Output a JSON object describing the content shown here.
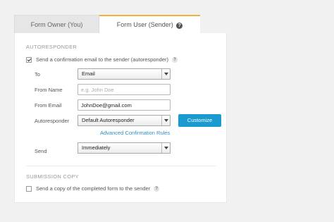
{
  "tabs": {
    "owner_label": "Form Owner (You)",
    "user_label": "Form User (Sender)",
    "user_help": "?"
  },
  "autoresponder": {
    "section_title": "AUTORESPONDER",
    "checkbox_label": "Send a confirmation email to the sender (autoresponder)",
    "checkbox_checked": true,
    "help": "?",
    "to_label": "To",
    "to_value": "Email",
    "from_name_label": "From Name",
    "from_name_placeholder": "e.g. John Doe",
    "from_email_label": "From Email",
    "from_email_value": "JohnDoe@gmail.com",
    "autoresponder_label": "Autoresponder",
    "autoresponder_value": "Default Autoresponder",
    "customize_button": "Customize",
    "advanced_link": "Advanced Confirmation Rules",
    "send_label": "Send",
    "send_value": "Immediately"
  },
  "submission_copy": {
    "section_title": "SUBMISSION COPY",
    "checkbox_label": "Send a copy of the completed form to the sender",
    "checkbox_checked": false,
    "help": "?"
  },
  "colors": {
    "accent_tab": "#f0b23b",
    "button": "#1b9ad2",
    "link": "#2a8fc5"
  },
  "icons": [
    "help-icon",
    "chevron-down-icon",
    "checkbox-icon"
  ]
}
